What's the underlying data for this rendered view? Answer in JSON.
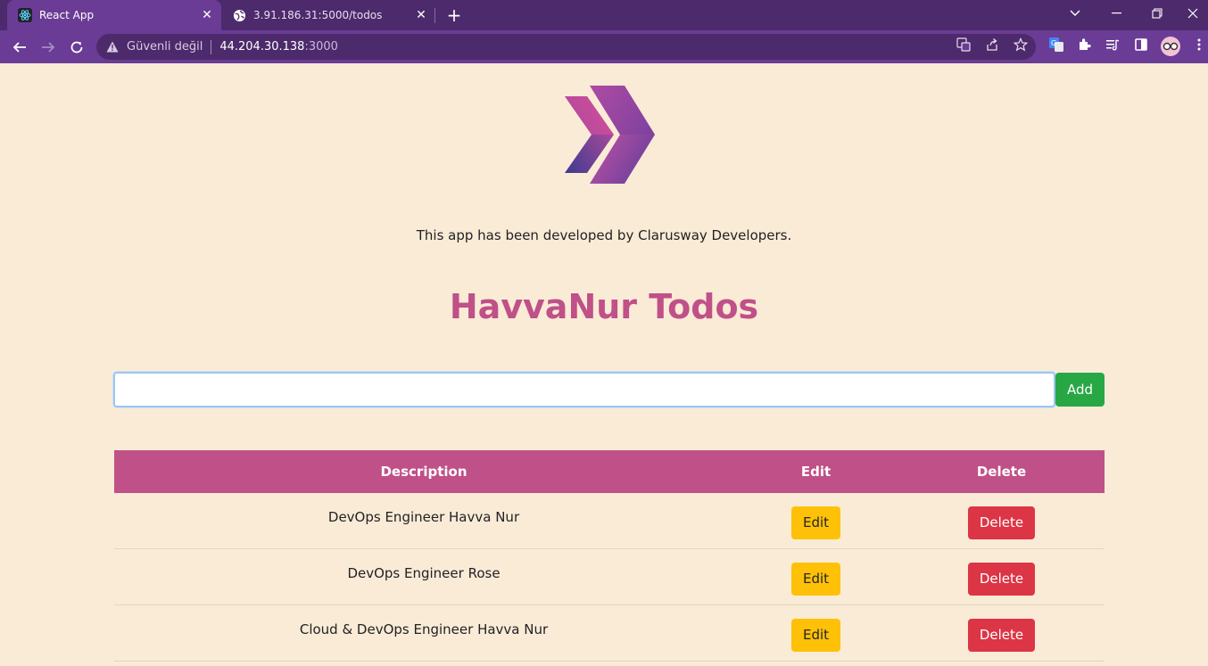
{
  "browser": {
    "tabs": [
      {
        "title": "React App",
        "active": true,
        "icon": "react-icon"
      },
      {
        "title": "3.91.186.31:5000/todos",
        "active": false,
        "icon": "globe-icon"
      }
    ],
    "address": {
      "security_label": "Güvenli değil",
      "host": "44.204.30.138",
      "port": ":3000"
    }
  },
  "page": {
    "credit": "This app has been developed by Clarusway Developers.",
    "title": "HavvaNur Todos",
    "input": {
      "value": "",
      "placeholder": ""
    },
    "add_label": "Add",
    "table": {
      "headers": {
        "description": "Description",
        "edit": "Edit",
        "delete": "Delete"
      },
      "rows": [
        {
          "description": "DevOps Engineer Havva Nur",
          "edit": "Edit",
          "delete": "Delete"
        },
        {
          "description": "DevOps Engineer Rose",
          "edit": "Edit",
          "delete": "Delete"
        },
        {
          "description": "Cloud & DevOps Engineer Havva Nur",
          "edit": "Edit",
          "delete": "Delete"
        }
      ]
    }
  },
  "colors": {
    "page_bg": "#faebd7",
    "brand": "#c05088",
    "browser_frame": "#6a3c96",
    "add": "#28a745",
    "edit": "#ffc107",
    "delete": "#dc3545"
  }
}
